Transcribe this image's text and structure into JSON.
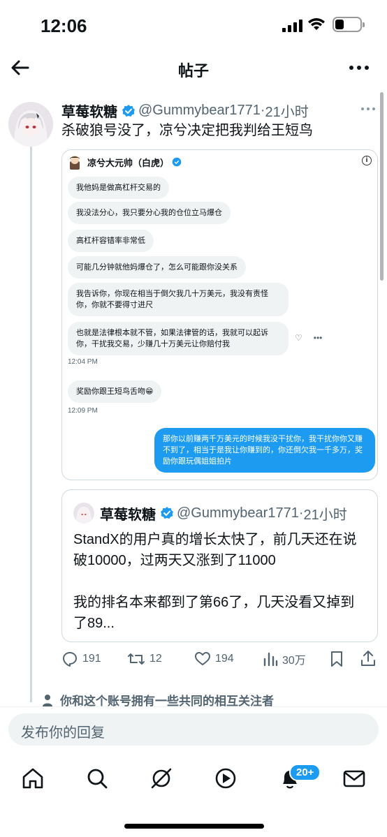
{
  "status": {
    "time": "12:06"
  },
  "header": {
    "title": "帖子"
  },
  "post": {
    "author": "草莓软糖",
    "handle": "@Gummybear1771",
    "time": "21小时",
    "text": "杀破狼号没了，凉兮决定把我判给王短鸟"
  },
  "embed": {
    "sender_name": "凉兮大元帅（白虎）",
    "messages": [
      "我他妈是做高杠杆交易的",
      "我没法分心，我只要分心我的仓位立马爆仓",
      "高杠杆容错率非常低",
      "可能几分钟就他妈爆仓了，怎么可能跟你没关系",
      "我告诉你，你现在相当于倒欠我几十万美元，我没有责怪你，你就不要得寸进尺",
      "也就是法律根本就不管，如果法律管的话，我就可以起诉你，干扰我交易，少赚几十万美元让你赔付我",
      "奖励你跟王短鸟舌吻😁"
    ],
    "time_1": "12:04 PM",
    "time_2": "12:09 PM",
    "my_message": "那你以前赚两千万美元的时候我没干扰你，我干扰你你又赚不到了，相当于是我让你赚到的，你还倒欠我一千多万，奖励你跟玩偶姐姐拍片"
  },
  "quote": {
    "author": "草莓软糖",
    "handle": "@Gummybear1771",
    "time": "21小时",
    "text": "StandX的用户真的增长太快了，前几天还在说破10000，过两天又涨到了11000\n\n我的排名本来都到了第66了，几天没看又掉到了89..."
  },
  "stats": {
    "replies": "191",
    "reposts": "12",
    "likes": "194",
    "views": "30万"
  },
  "mutual_text": "你和这个账号拥有一些共同的相互关注者",
  "reply": {
    "placeholder": "发布你的回复"
  },
  "nav": {
    "badge": "20+"
  },
  "colors": {
    "accent": "#1d9bf0",
    "text": "#0f1419",
    "muted": "#536471"
  }
}
